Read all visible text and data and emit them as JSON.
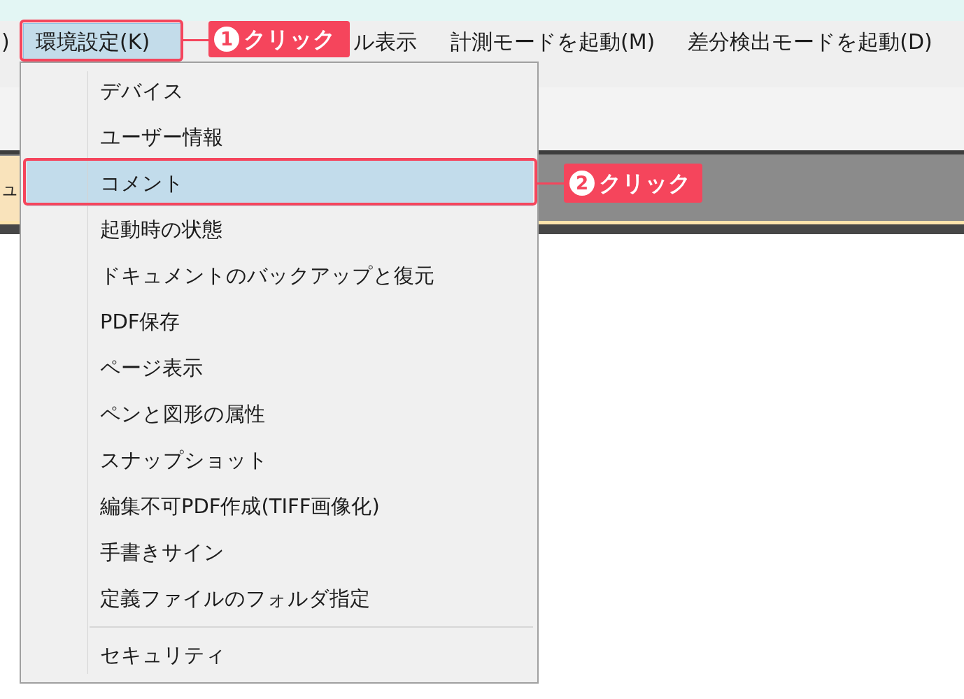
{
  "menu_bar": {
    "items": [
      {
        "label": ")",
        "selected": false
      },
      {
        "label": "環境設定(K)",
        "selected": true
      },
      {
        "label": "ル表示",
        "selected": false
      },
      {
        "label": "計測モードを起動(M)",
        "selected": false
      },
      {
        "label": "差分検出モードを起動(D)",
        "selected": false
      }
    ]
  },
  "document_tabs": [
    {
      "label": "ュ"
    }
  ],
  "dropdown": {
    "items": [
      {
        "kind": "item",
        "label": "デバイス",
        "selected": false
      },
      {
        "kind": "item",
        "label": "ユーザー情報",
        "selected": false
      },
      {
        "kind": "item",
        "label": "コメント",
        "selected": true
      },
      {
        "kind": "item",
        "label": "起動時の状態",
        "selected": false
      },
      {
        "kind": "item",
        "label": "ドキュメントのバックアップと復元",
        "selected": false
      },
      {
        "kind": "item",
        "label": "PDF保存",
        "selected": false
      },
      {
        "kind": "item",
        "label": "ページ表示",
        "selected": false
      },
      {
        "kind": "item",
        "label": "ペンと図形の属性",
        "selected": false
      },
      {
        "kind": "item",
        "label": "スナップショット",
        "selected": false
      },
      {
        "kind": "item",
        "label": "編集不可PDF作成(TIFF画像化)",
        "selected": false
      },
      {
        "kind": "item",
        "label": "手書きサイン",
        "selected": false
      },
      {
        "kind": "item",
        "label": "定義ファイルのフォルダ指定",
        "selected": false
      },
      {
        "kind": "separator"
      },
      {
        "kind": "item",
        "label": "セキュリティ",
        "selected": false
      }
    ]
  },
  "callouts": [
    {
      "number": "1",
      "text": "クリック"
    },
    {
      "number": "2",
      "text": "クリック"
    }
  ]
}
